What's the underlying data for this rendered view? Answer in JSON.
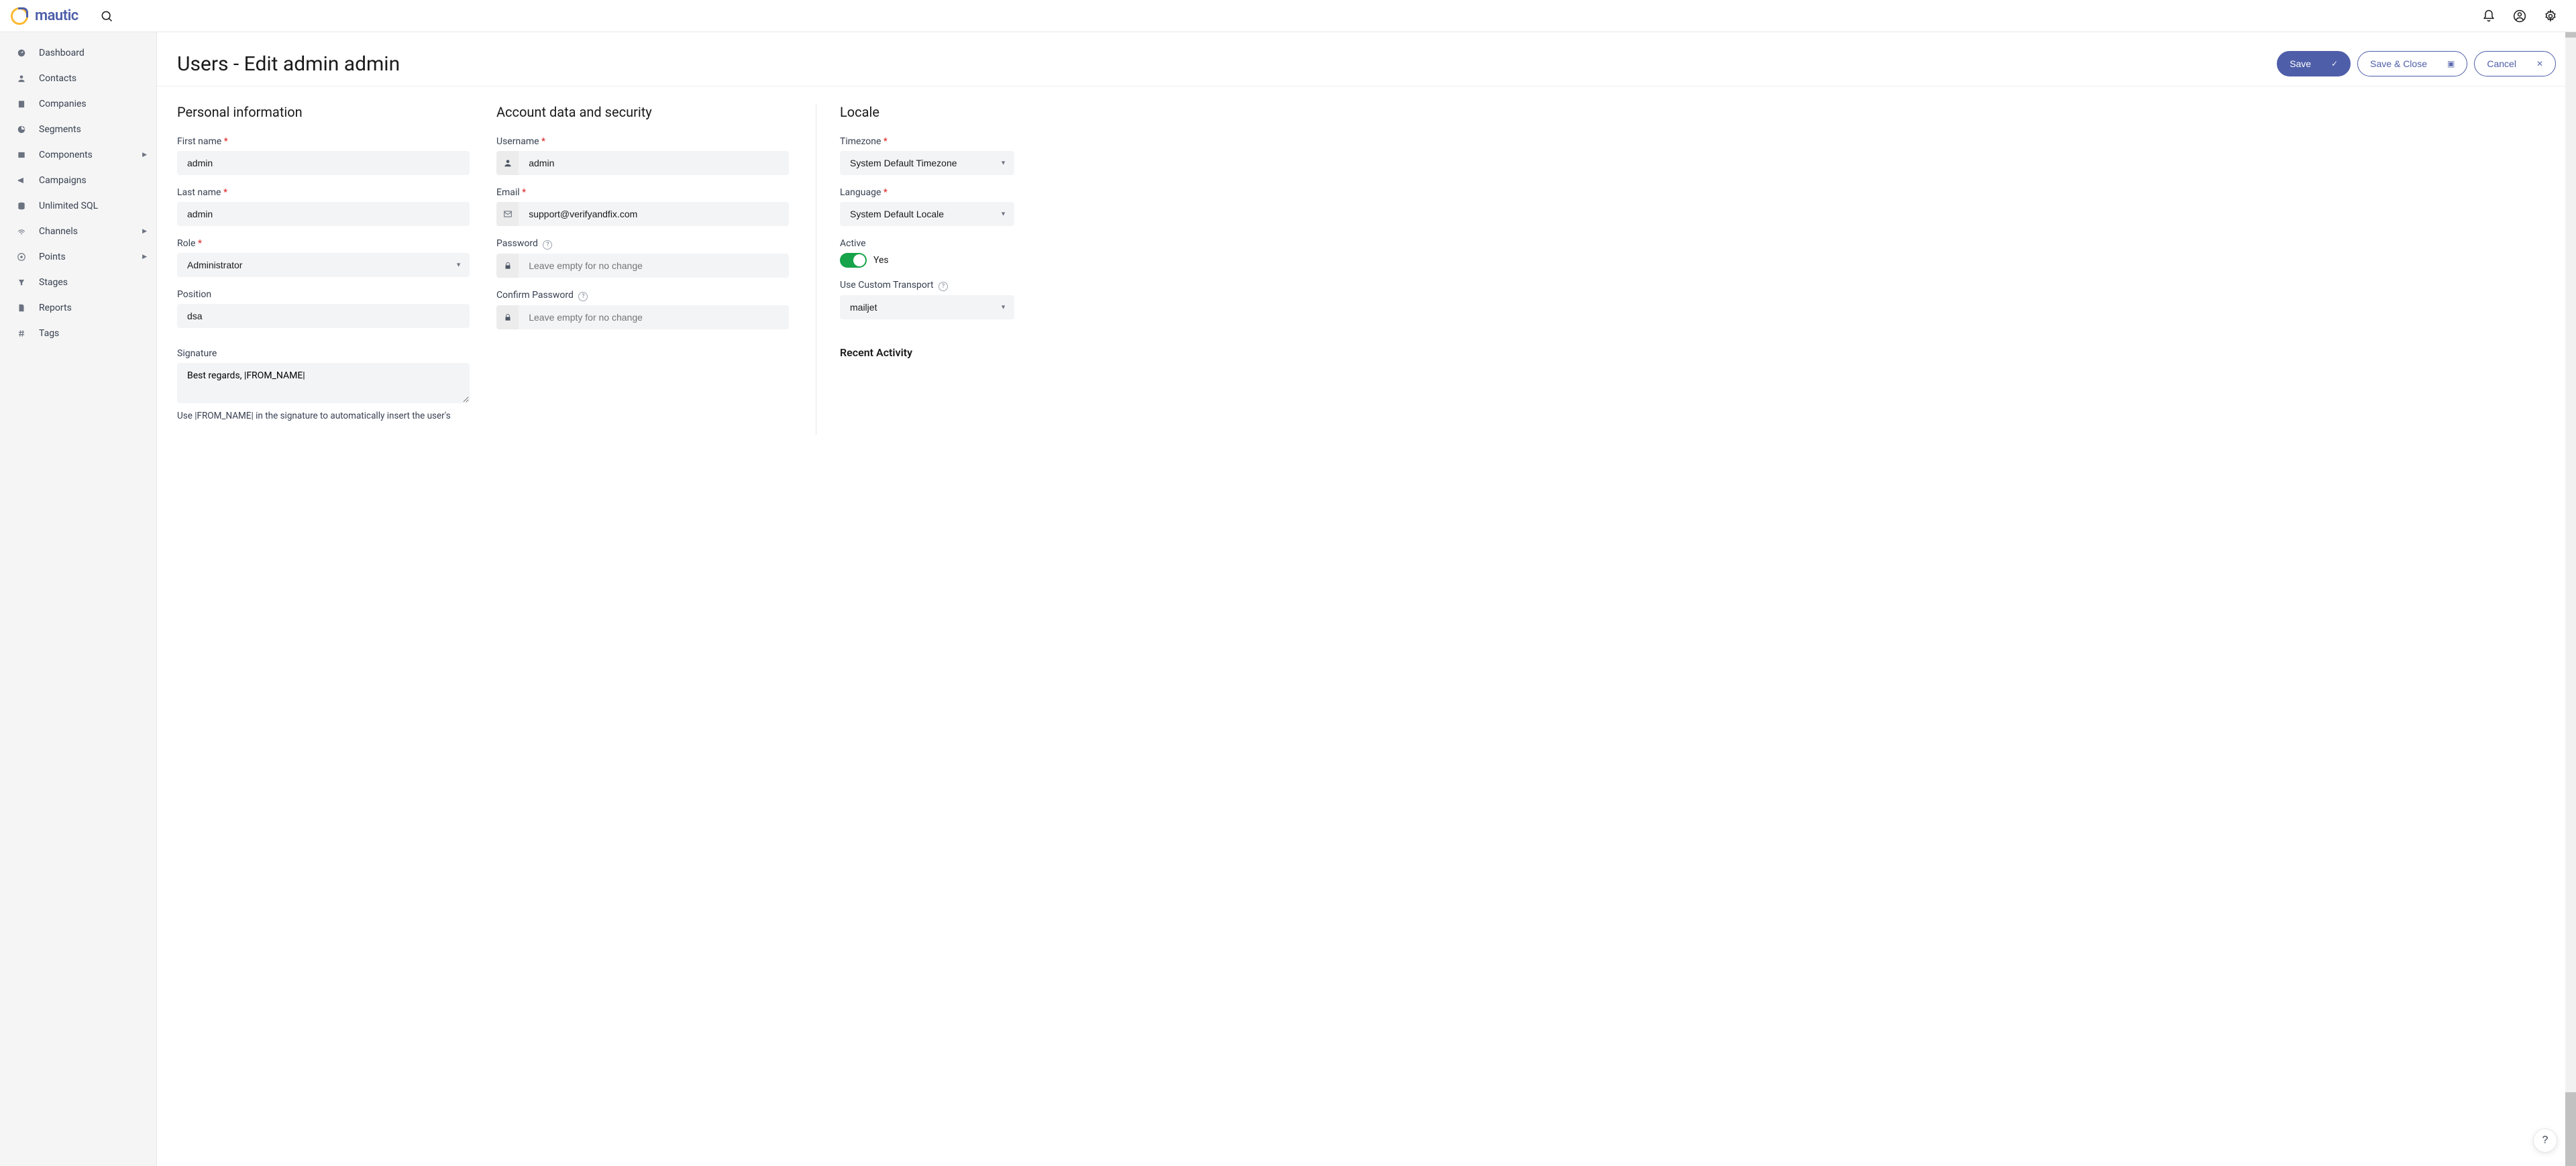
{
  "brand": "mautic",
  "sidebar": {
    "items": [
      {
        "label": "Dashboard",
        "icon": "gauge"
      },
      {
        "label": "Contacts",
        "icon": "user"
      },
      {
        "label": "Companies",
        "icon": "building"
      },
      {
        "label": "Segments",
        "icon": "pie"
      },
      {
        "label": "Components",
        "icon": "layers",
        "sub": true
      },
      {
        "label": "Campaigns",
        "icon": "megaphone"
      },
      {
        "label": "Unlimited SQL",
        "icon": "database"
      },
      {
        "label": "Channels",
        "icon": "wifi",
        "sub": true
      },
      {
        "label": "Points",
        "icon": "target",
        "sub": true
      },
      {
        "label": "Stages",
        "icon": "trash"
      },
      {
        "label": "Reports",
        "icon": "file"
      },
      {
        "label": "Tags",
        "icon": "hash"
      }
    ]
  },
  "page": {
    "title": "Users - Edit admin admin",
    "save": "Save",
    "save_close": "Save & Close",
    "cancel": "Cancel"
  },
  "personal": {
    "heading": "Personal information",
    "first_name_label": "First name",
    "first_name": "admin",
    "last_name_label": "Last name",
    "last_name": "admin",
    "role_label": "Role",
    "role": "Administrator",
    "position_label": "Position",
    "position": "dsa",
    "signature_label": "Signature",
    "signature": "Best regards, |FROM_NAME|",
    "signature_hint": "Use |FROM_NAME| in the signature to automatically insert the user's"
  },
  "account": {
    "heading": "Account data and security",
    "username_label": "Username",
    "username": "admin",
    "email_label": "Email",
    "email": "support@verifyandfix.com",
    "password_label": "Password",
    "password_placeholder": "Leave empty for no change",
    "confirm_label": "Confirm Password",
    "confirm_placeholder": "Leave empty for no change"
  },
  "locale": {
    "heading": "Locale",
    "timezone_label": "Timezone",
    "timezone": "System Default Timezone",
    "language_label": "Language",
    "language": "System Default Locale",
    "active_label": "Active",
    "active_value": "Yes",
    "transport_label": "Use Custom Transport",
    "transport": "mailjet",
    "recent": "Recent Activity"
  }
}
